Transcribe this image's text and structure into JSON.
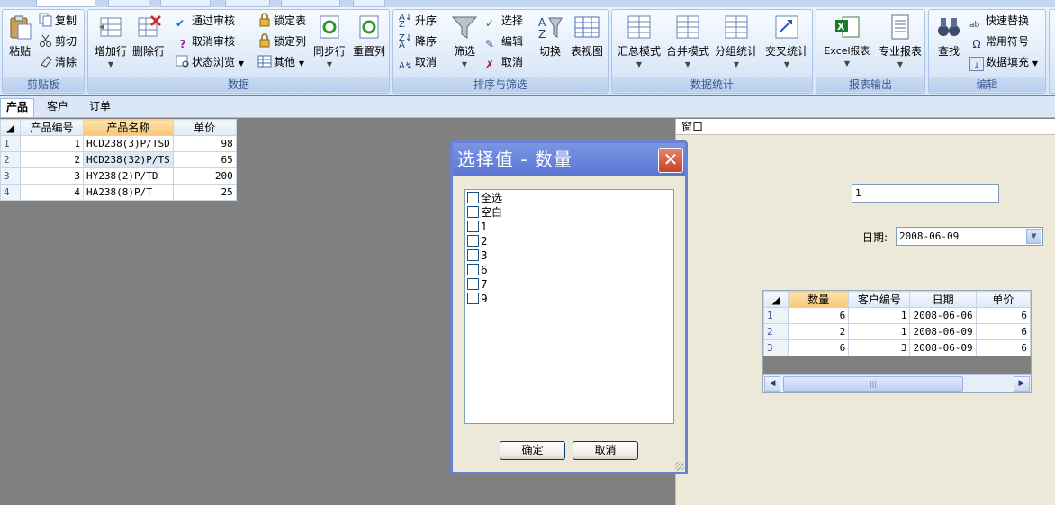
{
  "ribbon": {
    "clipboard": {
      "title": "剪贴板",
      "paste": "粘贴",
      "copy": "复制",
      "cut": "剪切",
      "clear": "清除"
    },
    "data": {
      "title": "数据",
      "add_row": "增加行",
      "delete_row": "删除行",
      "approve": "通过审核",
      "unapprove": "取消审核",
      "state_browse": "状态浏览",
      "lock_table": "锁定表",
      "lock_col": "锁定列",
      "other": "其他",
      "sync_row": "同步行",
      "reset_col": "重置列"
    },
    "sort": {
      "title": "排序与筛选",
      "asc": "升序",
      "desc": "降序",
      "cancel_sort": "取消",
      "filter": "筛选",
      "select": "选择",
      "edit": "编辑",
      "cancel_filter": "取消",
      "switch": "切换",
      "table_view": "表视图"
    },
    "stats": {
      "title": "数据统计",
      "summary": "汇总模式",
      "merge": "合并模式",
      "group": "分组统计",
      "cross": "交叉统计"
    },
    "report": {
      "title": "报表输出",
      "excel": "Excel报表",
      "pro": "专业报表"
    },
    "edit": {
      "title": "编辑",
      "find": "查找",
      "replace": "快速替换",
      "symbols": "常用符号",
      "fill": "数据填充"
    }
  },
  "sheet_tabs": [
    "产品",
    "客户",
    "订单"
  ],
  "products": {
    "columns": [
      "产品编号",
      "产品名称",
      "单价"
    ],
    "rows": [
      {
        "n": "1",
        "id": "1",
        "name": "HCD238(3)P/TSD",
        "price": "98"
      },
      {
        "n": "2",
        "id": "2",
        "name": "HCD238(32)P/TS",
        "price": "65"
      },
      {
        "n": "3",
        "id": "3",
        "name": "HY238(2)P/TD",
        "price": "200"
      },
      {
        "n": "4",
        "id": "4",
        "name": "HA238(8)P/T",
        "price": "25"
      }
    ]
  },
  "window": {
    "title": "窗口",
    "value_field": "1",
    "date_label": "日期:",
    "date_value": "2008-06-09",
    "orders": {
      "columns": [
        "数量",
        "客户编号",
        "日期",
        "单价"
      ],
      "rows": [
        {
          "n": "1",
          "qty": "6",
          "cust": "1",
          "date": "2008-06-06",
          "price": "6"
        },
        {
          "n": "2",
          "qty": "2",
          "cust": "1",
          "date": "2008-06-09",
          "price": "6"
        },
        {
          "n": "3",
          "qty": "6",
          "cust": "3",
          "date": "2008-06-09",
          "price": "6"
        }
      ]
    }
  },
  "dialog": {
    "title": "选择值 - 数量",
    "items": [
      "全选",
      "空白",
      "1",
      "2",
      "3",
      "6",
      "7",
      "9"
    ],
    "ok": "确定",
    "cancel": "取消"
  }
}
